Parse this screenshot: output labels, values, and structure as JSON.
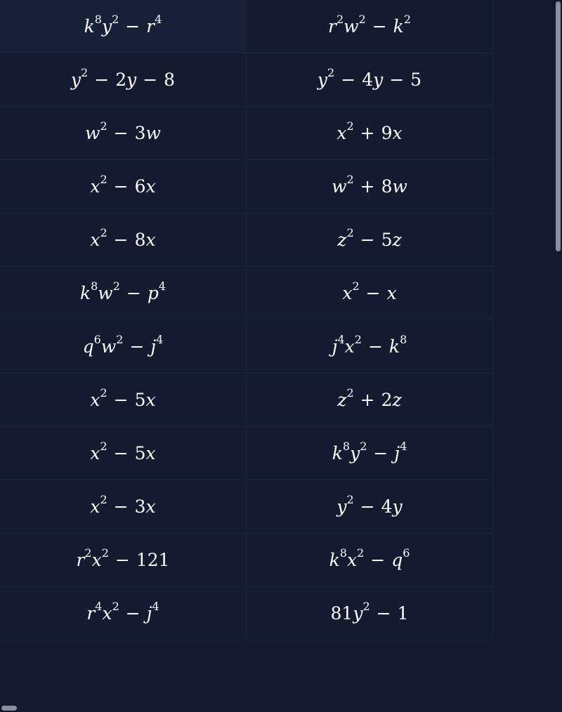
{
  "rows": [
    {
      "left": "k^8y^2 − r^4",
      "right": "r^2w^2 − k^2"
    },
    {
      "left": "y^2 − 2y − 8",
      "right": "y^2 − 4y − 5"
    },
    {
      "left": "w^2 − 3w",
      "right": "x^2 + 9x"
    },
    {
      "left": "x^2 − 6x",
      "right": "w^2 + 8w"
    },
    {
      "left": "x^2 − 8x",
      "right": "z^2 − 5z"
    },
    {
      "left": "k^8w^2 − p^4",
      "right": "x^2 − x"
    },
    {
      "left": "q^6w^2 − j^4",
      "right": "j^4x^2 − k^8"
    },
    {
      "left": "x^2 − 5x",
      "right": "z^2 + 2z"
    },
    {
      "left": "x^2 − 5x",
      "right": "k^8y^2 − j^4"
    },
    {
      "left": "x^2 − 3x",
      "right": "y^2 − 4y"
    },
    {
      "left": "r^2x^2 − 121",
      "right": "k^8x^2 − q^6"
    },
    {
      "left": "r^4x^2 − j^4",
      "right": "81y^2 − 1"
    }
  ]
}
